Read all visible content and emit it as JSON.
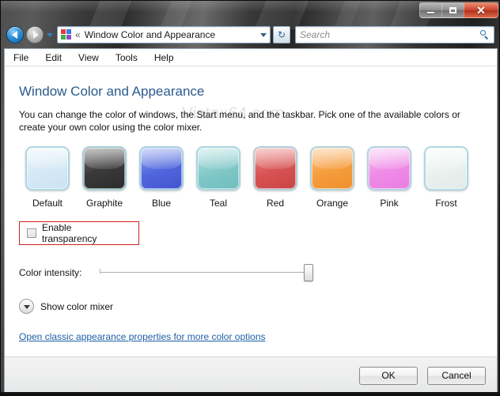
{
  "window": {
    "controls": {
      "minimize_icon": "minimize-icon",
      "maximize_icon": "maximize-icon",
      "close_icon": "close-icon",
      "close_glyph": "✕"
    }
  },
  "toolbar": {
    "back_icon": "back-arrow-icon",
    "forward_icon": "forward-arrow-icon",
    "recent_pages_icon": "chevron-down-icon",
    "address": {
      "icon": "control-panel-icon",
      "chevron": "«",
      "text": "Window Color and Appearance",
      "dropdown_icon": "chevron-down-icon"
    },
    "refresh_icon": "refresh-icon",
    "refresh_glyph": "↻",
    "search": {
      "placeholder": "Search",
      "icon": "search-icon"
    }
  },
  "menubar": {
    "items": [
      {
        "label": "File"
      },
      {
        "label": "Edit"
      },
      {
        "label": "View"
      },
      {
        "label": "Tools"
      },
      {
        "label": "Help"
      }
    ]
  },
  "watermark": "Vistax64.com",
  "page": {
    "title": "Window Color and Appearance",
    "description": "You can change the color of windows, the Start menu, and the taskbar. Pick one of the available colors or create your own color using the color mixer."
  },
  "swatches": [
    {
      "label": "Default",
      "color": "#dbebf6",
      "gradient": "linear-gradient(160deg, #eaf4fb 0%, #d4e8f5 55%, #cde3f2 100%)"
    },
    {
      "label": "Graphite",
      "color": "#4a4a4a",
      "gradient": "linear-gradient(160deg, #6f6f6f 0%, #3a3a3a 50%, #2b2b2b 100%)"
    },
    {
      "label": "Blue",
      "color": "#5b78e0",
      "gradient": "linear-gradient(160deg, #8fa3f0 0%, #5167de 52%, #4254cf 100%)"
    },
    {
      "label": "Teal",
      "color": "#8cd0d0",
      "gradient": "linear-gradient(160deg, #b4e2e0 0%, #81c8c8 55%, #6fbcbd 100%)"
    },
    {
      "label": "Red",
      "color": "#dd5f5f",
      "gradient": "linear-gradient(160deg, #ef8b8b 0%, #d85454 52%, #c94545 100%)"
    },
    {
      "label": "Orange",
      "color": "#f5a348",
      "gradient": "linear-gradient(160deg, #fbc183 0%, #f59d3e 52%, #ef8f2c 100%)"
    },
    {
      "label": "Pink",
      "color": "#f09de8",
      "gradient": "linear-gradient(160deg, #f7c3f2 0%, #ef8ce7 52%, #ea7ce1 100%)"
    },
    {
      "label": "Frost",
      "color": "#eef4f2",
      "gradient": "linear-gradient(160deg, #f8fbfa 0%, #e9f1ef 55%, #e2ebe9 100%)"
    }
  ],
  "transparency": {
    "label": "Enable transparency",
    "checked": false,
    "highlight_color": "#cc2222"
  },
  "intensity": {
    "label": "Color intensity:",
    "value": 100,
    "min": 0,
    "max": 100
  },
  "color_mixer": {
    "label": "Show color mixer",
    "icon": "chevron-down-icon",
    "expanded": false
  },
  "classic_link": {
    "label": "Open classic appearance properties for more color options",
    "color": "#1f5fa8"
  },
  "footer": {
    "ok_label": "OK",
    "cancel_label": "Cancel"
  }
}
